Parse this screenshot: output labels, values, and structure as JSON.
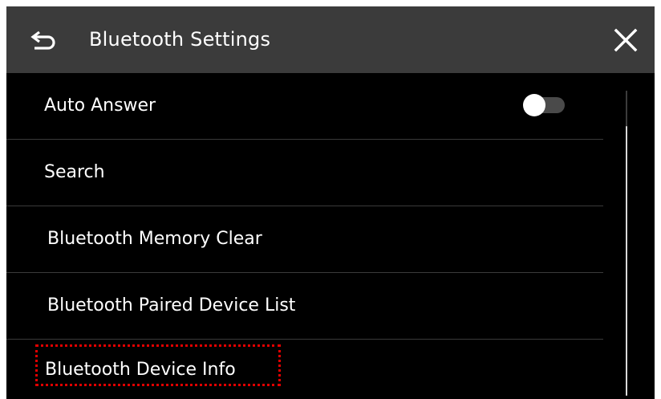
{
  "header": {
    "title": "Bluetooth Settings",
    "back_icon": "back-arrow-icon",
    "close_icon": "close-icon"
  },
  "settings": {
    "items": [
      {
        "label": "Auto Answer",
        "control": "toggle",
        "toggle_on": false
      },
      {
        "label": "Search"
      },
      {
        "label": "Bluetooth Memory Clear"
      },
      {
        "label": "Bluetooth Paired Device List"
      },
      {
        "label": "Bluetooth Device Info"
      }
    ]
  },
  "colors": {
    "background": "#000000",
    "header_background": "#3b3b3b",
    "text": "#ffffff",
    "divider": "#3a3a3a",
    "highlight_border": "#e00000"
  }
}
